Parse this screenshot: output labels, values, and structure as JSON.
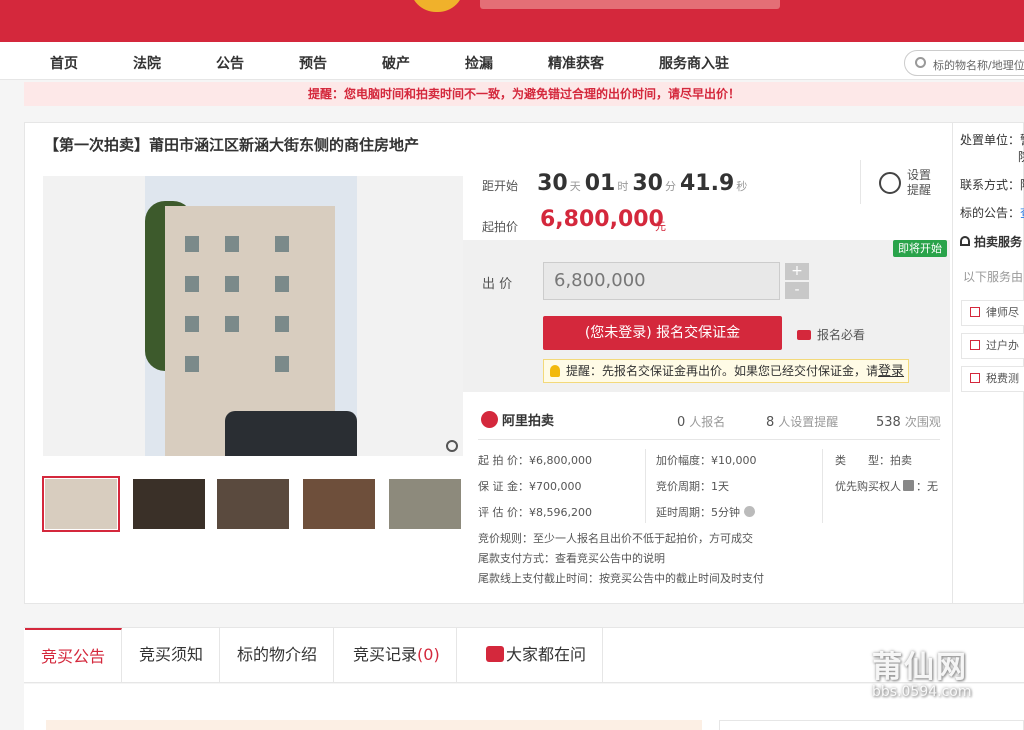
{
  "nav": [
    "首页",
    "法院",
    "公告",
    "预告",
    "破产",
    "捡漏",
    "精准获客",
    "服务商入驻"
  ],
  "search": {
    "placeholder": "标的物名称/地理位置"
  },
  "notice": "提醒：您电脑时间和拍卖时间不一致，为避免错过合理的出价时间，请尽早出价！",
  "title": "【第一次拍卖】莆田市涵江区新涵大街东侧的商住房地产",
  "countdown": {
    "label": "距开始",
    "days": "30",
    "days_unit": "天",
    "hours": "01",
    "hours_unit": "时",
    "minutes": "30",
    "minutes_unit": "分",
    "seconds": "41.9",
    "seconds_unit": "秒"
  },
  "remind": {
    "label": "设置提醒",
    "icon": "alarm-clock-icon"
  },
  "start_price": {
    "label": "起拍价",
    "value": "6,800,000",
    "unit": "元"
  },
  "badge": "即将开始",
  "bid": {
    "label": "出 价",
    "value": "6,800,000",
    "plus": "+",
    "minus": "-"
  },
  "signup_button": "(您未登录) 报名交保证金",
  "must_read": "报名必看",
  "tip": {
    "prefix": "提醒：先报名交保证金再出价。如果您已经交付保证金，请",
    "link": "登录"
  },
  "platform": "阿里拍卖",
  "stats": {
    "signups": "0",
    "signups_label": "人报名",
    "reminders": "8",
    "reminders_label": "人设置提醒",
    "views": "538",
    "views_label": "次围观"
  },
  "info": {
    "start_price": "起 拍 价：¥6,800,000",
    "deposit": "保 证 金：¥700,000",
    "appraisal": "评 估 价：¥8,596,200",
    "increment": "加价幅度：¥10,000",
    "cycle": "竞价周期：1天",
    "delay": "延时周期：5分钟",
    "type_key": "类　　型：",
    "type_val": "拍卖",
    "priority": "优先购买权人",
    "priority_val": "：无",
    "rule": "竞价规则：至少一人报名且出价不低于起拍价，方可成交",
    "payment": "尾款支付方式：查看竞买公告中的说明",
    "deadline": "尾款线上支付截止时间：按竞买公告中的截止时间及时支付"
  },
  "right": {
    "unit": "处置单位：",
    "unit_a": "警",
    "unit_b": "院",
    "contact": "联系方式：",
    "contact_val": "陈",
    "notice": "标的公告：",
    "notice_val": "查",
    "service": "拍卖服务",
    "service_sub": "以下服务由",
    "btn1": "律师尽",
    "btn2": "过户办",
    "btn3": "税费测"
  },
  "tabs": [
    {
      "label": "竞买公告"
    },
    {
      "label": "竞买须知"
    },
    {
      "label": "标的物介绍"
    },
    {
      "label": "竞买记录",
      "count": "(0)"
    },
    {
      "label": "大家都在问"
    }
  ],
  "watermark": {
    "name": "莆仙网",
    "url": "bbs.0594.com"
  }
}
